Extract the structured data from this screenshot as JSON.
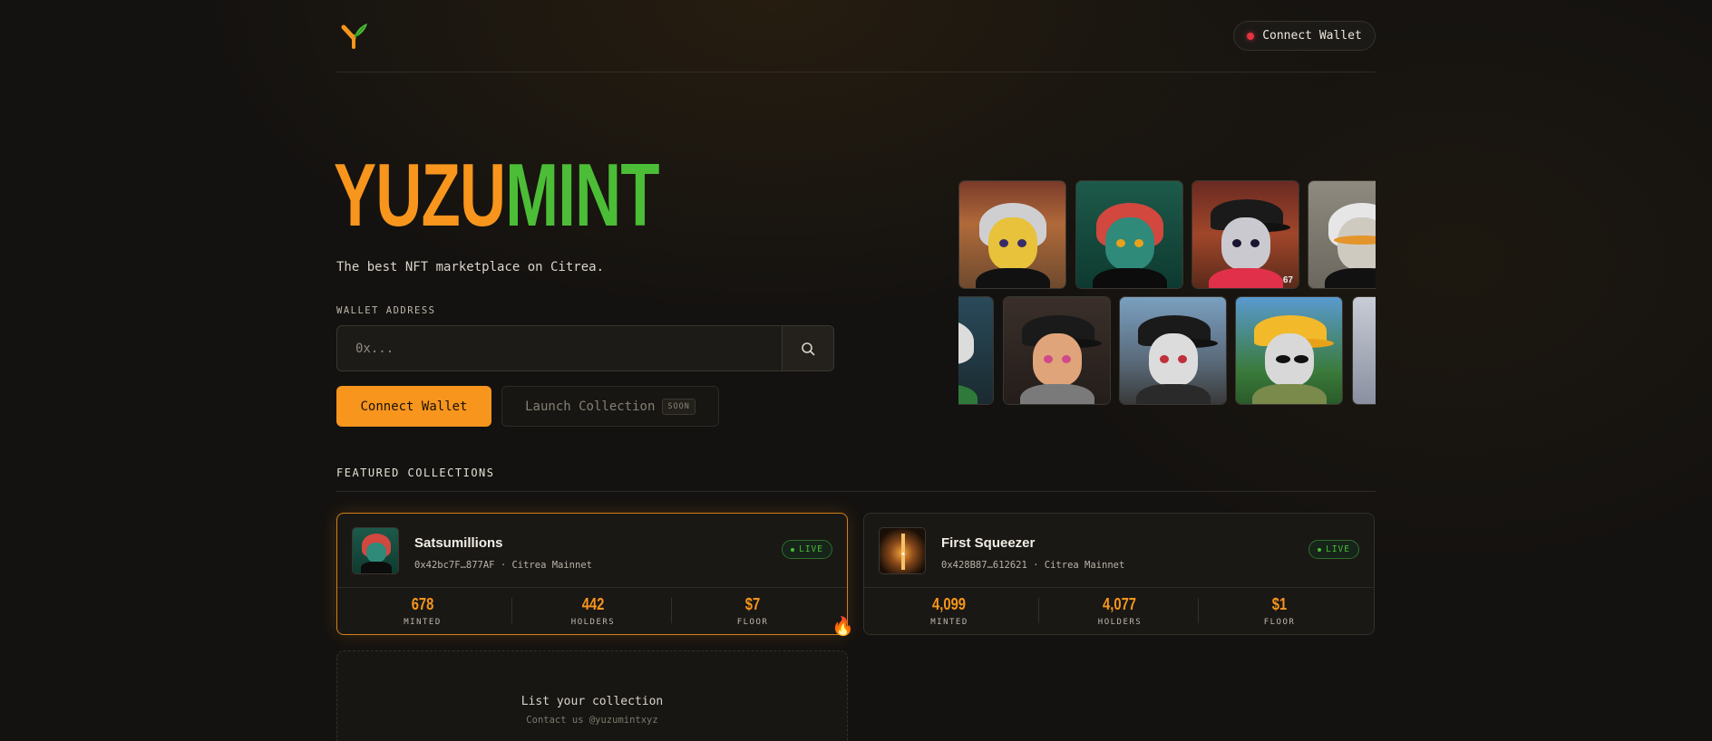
{
  "header": {
    "logo_icon": "yuzu-leaf-logo",
    "connect_label": "Connect Wallet",
    "status_color": "#e5343f"
  },
  "hero": {
    "title_part1": "YUZU",
    "title_part2": "MINT",
    "title_color1": "#f7951d",
    "title_color2": "#4cbd36",
    "tagline": "The best NFT marketplace on Citrea.",
    "wallet_label": "WALLET ADDRESS",
    "wallet_placeholder": "0x...",
    "search_icon": "search-icon",
    "connect_label": "Connect Wallet",
    "launch_label": "Launch Collection",
    "launch_badge": "SOON"
  },
  "gallery": {
    "badge_number": "67"
  },
  "featured": {
    "heading": "FEATURED COLLECTIONS",
    "collections": [
      {
        "name": "Satsumillions",
        "address": "0x42bc7F…877AF · Citrea Mainnet",
        "status": "LIVE",
        "stats": [
          {
            "value": "678",
            "label": "MINTED"
          },
          {
            "value": "442",
            "label": "HOLDERS"
          },
          {
            "value": "$7",
            "label": "FLOOR"
          }
        ]
      },
      {
        "name": "First Squeezer",
        "address": "0x428B87…612621 · Citrea Mainnet",
        "status": "LIVE",
        "stats": [
          {
            "value": "4,099",
            "label": "MINTED"
          },
          {
            "value": "4,077",
            "label": "HOLDERS"
          },
          {
            "value": "$1",
            "label": "FLOOR"
          }
        ]
      }
    ],
    "list_title": "List your collection",
    "list_subtitle": "Contact us @yuzumintxyz",
    "fire_icon": "🔥"
  }
}
